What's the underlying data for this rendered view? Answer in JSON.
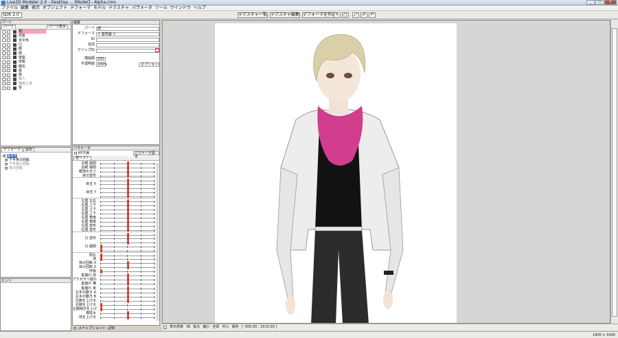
{
  "window": {
    "title": "Live2D Modeler 2.0 - Desktop ... [Model] - Alpha.cmo",
    "buttons": [
      "_",
      "□",
      "×"
    ]
  },
  "menu": [
    "ファイル",
    "編集",
    "表示",
    "オブジェクト",
    "デフォーマ",
    "モデル",
    "テクスチャ",
    "パラメータ",
    "ツール",
    "ウインドウ",
    "ヘルプ"
  ],
  "toolbar": {
    "sdk_select": "SDK 2.0 ...",
    "buttons": [
      "テクスチャ一覧",
      "テクスチャ編集",
      "デフォーマを作成"
    ]
  },
  "parts_panel": {
    "title": "パーツ",
    "header": "パーツ",
    "tabs": [
      "パーツ",
      "パーツ表示"
    ],
    "items": [
      {
        "name": "顔",
        "state": "sel"
      },
      {
        "name": "前髪",
        "state": ""
      },
      {
        "name": "まゆ毛",
        "state": ""
      },
      {
        "name": "口",
        "state": ""
      },
      {
        "name": "眼",
        "state": ""
      },
      {
        "name": "顔",
        "state": ""
      },
      {
        "name": "後髪",
        "state": ""
      },
      {
        "name": "体転",
        "state": ""
      },
      {
        "name": "腕右",
        "state": ""
      },
      {
        "name": "首",
        "state": ""
      },
      {
        "name": "体",
        "state": ""
      },
      {
        "name": "胴人",
        "state": "dim"
      },
      {
        "name": "胸部上体",
        "state": "dim"
      },
      {
        "name": "背",
        "state": ""
      }
    ]
  },
  "deformer_panel": {
    "tabs": [
      "デフォーマ",
      "設定"
    ],
    "items": [
      {
        "name": "基本形",
        "state": "sel"
      },
      {
        "name": "下半身の回転",
        "state": ""
      },
      {
        "name": "下半身の回転",
        "state": "dim"
      },
      {
        "name": "体の回転",
        "state": "dim"
      }
    ]
  },
  "hint_panel": {
    "title": "ヒント"
  },
  "props_panel": {
    "title": "編集",
    "rows": [
      {
        "label": "パーツ",
        "value": "顔"
      },
      {
        "label": "デフォーマ",
        "value": "< 基準面 >"
      },
      {
        "label": "ID",
        "value": ""
      },
      {
        "label": "名前",
        "value": ""
      },
      {
        "label": "クリップID",
        "value": ""
      }
    ],
    "draw_order_label": "描画順",
    "draw_order_value": "500",
    "opacity_label": "不透明度",
    "opacity_value": "100%",
    "option_button": "オプション"
  },
  "params_panel": {
    "title": "パラメータ",
    "header_check": "KP交差",
    "header_btn": "パラメータ設定",
    "tab": "値リスト",
    "rows": [
      {
        "label": "左眼 開閉",
        "pos": 0.5
      },
      {
        "label": "右眼 開閉",
        "pos": 0.5
      },
      {
        "label": "眼球大きさ",
        "pos": 0.5
      },
      {
        "label": "目の変形",
        "pos": 0.5
      },
      {
        "label": "",
        "pos": 0.5
      },
      {
        "label": "目玉 X",
        "pos": 0.5
      },
      {
        "label": "",
        "pos": 0.5
      },
      {
        "label": "目玉 Y",
        "pos": 0.5
      },
      {
        "label": "",
        "pos": 0.5
      },
      {
        "label": "左眉 左右",
        "pos": 0.5
      },
      {
        "label": "右眉 上下",
        "pos": 0.5
      },
      {
        "label": "左眉 上下",
        "pos": 0.5
      },
      {
        "label": "右眉 上下",
        "pos": 0.5
      },
      {
        "label": "左眉 角度",
        "pos": 0.5
      },
      {
        "label": "右眉 角度",
        "pos": 0.5
      },
      {
        "label": "左眉 変形",
        "pos": 0.5
      },
      {
        "label": "右眉 変形",
        "pos": 0.5
      },
      {
        "label": "",
        "pos": 0.5
      },
      {
        "label": "口 変形",
        "pos": 0.5
      },
      {
        "label": "",
        "pos": 0.5
      },
      {
        "label": "口 開閉",
        "pos": 0.0
      },
      {
        "label": "",
        "pos": 0.0
      },
      {
        "label": "照れ",
        "pos": 0.0
      },
      {
        "label": "涙",
        "pos": 0.0
      },
      {
        "label": "体の回転 X",
        "pos": 0.5
      },
      {
        "label": "体の回転 Z",
        "pos": 0.5
      },
      {
        "label": "呼吸",
        "pos": 0.0
      },
      {
        "label": "髪揺れ 前",
        "pos": 0.5
      },
      {
        "label": "アクセサリ揺れ",
        "pos": 0.5
      },
      {
        "label": "髪揺れ 横",
        "pos": 0.5
      },
      {
        "label": "髪揺れ 後",
        "pos": 0.5
      },
      {
        "label": "左手の動き A",
        "pos": 0.5
      },
      {
        "label": "左手の動き B",
        "pos": 0.5
      },
      {
        "label": "左腕を上げる",
        "pos": 0.5
      },
      {
        "label": "右腕を上げる",
        "pos": 0.0
      },
      {
        "label": "左腕時計を上げ",
        "pos": 0.0
      },
      {
        "label": "襟拡大",
        "pos": 0.5
      },
      {
        "label": "体を上げる",
        "pos": 0.5
      }
    ],
    "footer_check": "スナップショット",
    "footer_label": "記憶"
  },
  "canvas": {
    "bottom_items": [
      "表示倍率",
      "36",
      "拡大",
      "縮小",
      "全体",
      "中心",
      "保存",
      "[ -500.00 , 1510.00 ]"
    ]
  },
  "status": {
    "resolution": "1800 × 5000"
  },
  "colors": {
    "selection_pink": "#f5a1b8",
    "knob_red": "#d53a2c",
    "selection_blue": "#3c6fc8"
  }
}
